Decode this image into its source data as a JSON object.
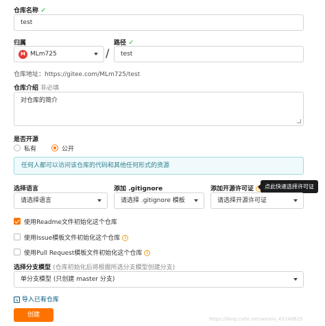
{
  "repo_name": {
    "label": "仓库名称",
    "value": "test"
  },
  "owner": {
    "label": "归属",
    "avatar_letter": "M",
    "value": "MLm725",
    "separator": "/"
  },
  "path": {
    "label": "路径",
    "value": "test"
  },
  "repo_url": {
    "label": "仓库地址：",
    "value": "https://gitee.com/MLm725/test"
  },
  "description": {
    "label": "仓库介绍",
    "hint": "非必填",
    "value": "对仓库的简介"
  },
  "visibility": {
    "label": "是否开源",
    "options": [
      "私有",
      "公开"
    ],
    "selected": "公开",
    "message": "任何人都可以访问该仓库的代码和其他任何形式的资源"
  },
  "language": {
    "label": "选择语言",
    "value": "请选择语言"
  },
  "gitignore": {
    "label": "添加 .gitignore",
    "value": "请选择 .gitignore 模板"
  },
  "license": {
    "label": "添加开源许可证",
    "value": "请选择开源许可证",
    "tooltip": "点此快速选择许可证"
  },
  "init_options": [
    {
      "label": "使用Readme文件初始化这个仓库",
      "checked": true
    },
    {
      "label": "使用Issue模板文件初始化这个仓库",
      "checked": false
    },
    {
      "label": "使用Pull Request模板文件初始化这个仓库",
      "checked": false
    }
  ],
  "branch_model": {
    "label": "选择分支模型",
    "hint": "(仓库初始化后将根据所选分支模型创建分支)",
    "value": "单分支模型 (只创建 master 分支)"
  },
  "import_link": "导入已有仓库",
  "create_button": "创建",
  "watermark": "https://blog.csdn.net/weixin_45148825",
  "colors": {
    "accent": "#fe7300",
    "check": "#21ba45",
    "info_bg": "#f0fafc",
    "info_border": "#9cd8e0",
    "link": "#005980"
  }
}
